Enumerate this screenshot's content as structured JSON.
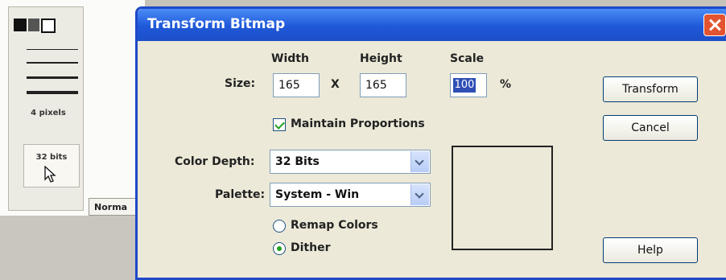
{
  "background": {
    "stroke_label": "4 pixels",
    "bits_label": "32 bits",
    "normal_tab": "Norma"
  },
  "dialog": {
    "title": "Transform Bitmap",
    "size_label": "Size:",
    "width_header": "Width",
    "height_header": "Height",
    "scale_header": "Scale",
    "width_value": "165",
    "x_sep": "X",
    "height_value": "165",
    "scale_value": "100",
    "percent": "%",
    "maintain_label": "Maintain Proportions",
    "color_depth_label": "Color Depth:",
    "color_depth_value": "32 Bits",
    "palette_label": "Palette:",
    "palette_value": "System - Win",
    "remap_label": "Remap Colors",
    "dither_label": "Dither",
    "transform_btn": "Transform",
    "cancel_btn": "Cancel",
    "help_btn": "Help"
  },
  "colors": {
    "titlebar": "#1e58d8",
    "dialog_bg": "#ece9d8",
    "close": "#e2542f",
    "check": "#21a121"
  }
}
